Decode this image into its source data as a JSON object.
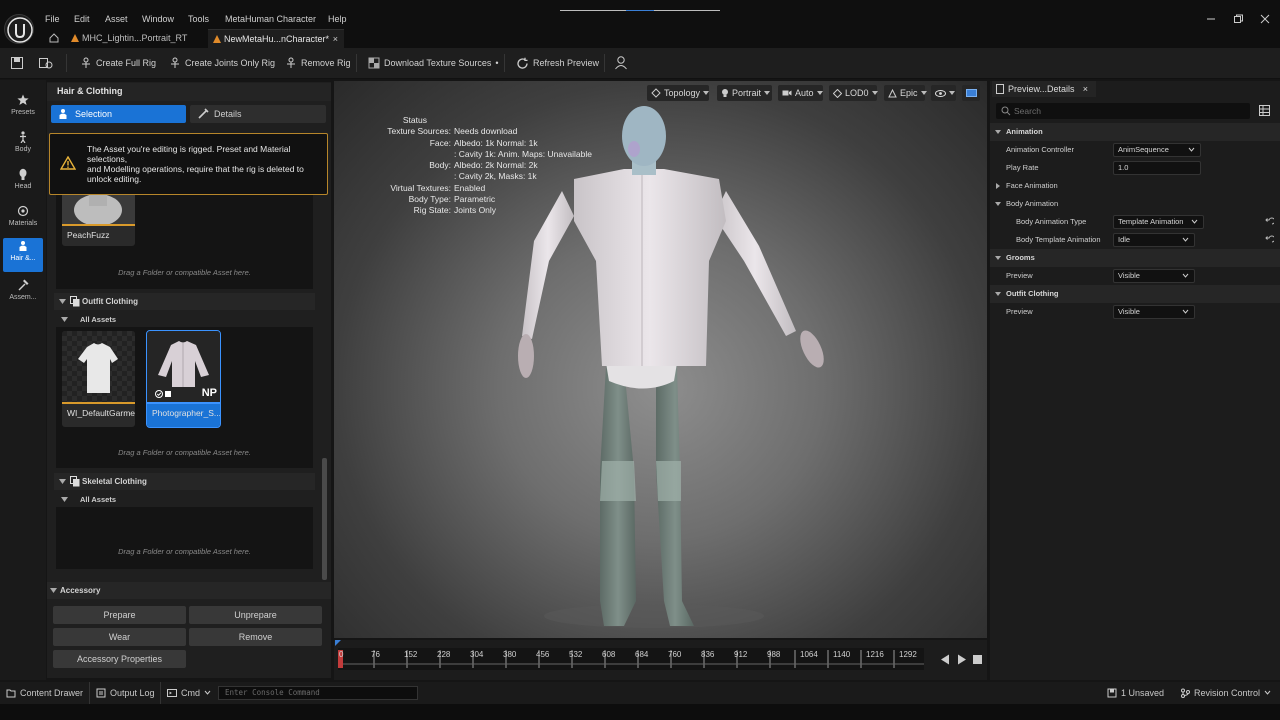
{
  "menu": [
    "File",
    "Edit",
    "Asset",
    "Window",
    "Tools",
    "MetaHuman Character",
    "Help"
  ],
  "tabs": [
    {
      "label": "MHC_Lightin...Portrait_RT"
    },
    {
      "label": "NewMetaHu...nCharacter*",
      "close": "×"
    }
  ],
  "toolbar": {
    "create_full_rig": "Create Full Rig",
    "create_joints_rig": "Create Joints Only Rig",
    "remove_rig": "Remove Rig",
    "download_textures": "Download Texture Sources",
    "refresh_preview": "Refresh Preview"
  },
  "rail": [
    {
      "label": "Presets",
      "icon": "star-icon"
    },
    {
      "label": "Body",
      "icon": "body-icon"
    },
    {
      "label": "Head",
      "icon": "head-icon"
    },
    {
      "label": "Materials",
      "icon": "materials-icon"
    },
    {
      "label": "Hair &...",
      "icon": "hair-icon"
    },
    {
      "label": "Assem...",
      "icon": "hammer-icon"
    }
  ],
  "left_panel": {
    "title": "Hair & Clothing",
    "selection_tab": "Selection",
    "details_tab": "Details",
    "warning": "The Asset you're editing is rigged. Preset and Material selections,\nand Modelling operations, require that the rig is deleted to unlock editing.",
    "peachfuzz": "PeachFuzz",
    "drag_hint": "Drag a Folder or compatible Asset here.",
    "outfit_header": "Outfit Clothing",
    "all_assets": "All Assets",
    "asset1": "WI_DefaultGarment",
    "asset2": "Photographer_S...",
    "np_badge": "NP",
    "skeletal_header": "Skeletal Clothing",
    "accessory_header": "Accessory",
    "buttons": {
      "prepare": "Prepare",
      "unprepare": "Unprepare",
      "wear": "Wear",
      "remove": "Remove",
      "accessory_props": "Accessory Properties"
    }
  },
  "viewport": {
    "topology": "Topology",
    "portrait": "Portrait",
    "auto": "Auto",
    "lod": "LOD0",
    "epic": "Epic",
    "status_title": "Status",
    "status": [
      {
        "k": "Texture Sources:",
        "v": "Needs download"
      },
      {
        "k": "Face:",
        "v": "Albedo: 1k Normal: 1k"
      },
      {
        "k": "",
        "v": ": Cavity 1k: Anim. Maps: Unavailable"
      },
      {
        "k": "Body:",
        "v": "Albedo: 2k Normal: 2k"
      },
      {
        "k": "",
        "v": ": Cavity 2k, Masks: 1k"
      },
      {
        "k": "Virtual Textures:",
        "v": "Enabled"
      },
      {
        "k": "Body Type:",
        "v": "Parametric"
      },
      {
        "k": "Rig State:",
        "v": "Joints Only"
      }
    ]
  },
  "timeline": {
    "start": "0",
    "ticks": [
      "76",
      "152",
      "228",
      "304",
      "380",
      "456",
      "532",
      "608",
      "684",
      "760",
      "836",
      "912",
      "988",
      "1064",
      "1140",
      "1216",
      "1292"
    ]
  },
  "right_panel": {
    "tab": "Preview...Details",
    "close": "×",
    "search_placeholder": "Search",
    "rows": [
      {
        "label": "Animation",
        "type": "cat"
      },
      {
        "label": "Animation Controller",
        "value": "AnimSequence",
        "type": "prop"
      },
      {
        "label": "Play Rate",
        "value": "1.0",
        "type": "num"
      },
      {
        "label": "Face Animation",
        "type": "cat-collapsed"
      },
      {
        "label": "Body Animation",
        "type": "cat-sub"
      },
      {
        "label": "Body Animation Type",
        "value": "Template Animation",
        "type": "prop-indent"
      },
      {
        "label": "Body Template Animation",
        "value": "Idle",
        "type": "prop-indent"
      },
      {
        "label": "Grooms",
        "type": "cat"
      },
      {
        "label": "Preview",
        "value": "Visible",
        "type": "prop"
      },
      {
        "label": "Outfit Clothing",
        "type": "cat"
      },
      {
        "label": "Preview",
        "value": "Visible",
        "type": "prop"
      }
    ]
  },
  "statusbar": {
    "content_drawer": "Content Drawer",
    "output_log": "Output Log",
    "cmd": "Cmd",
    "console_placeholder": "Enter Console Command",
    "unsaved": "1 Unsaved",
    "revision_control": "Revision Control"
  }
}
